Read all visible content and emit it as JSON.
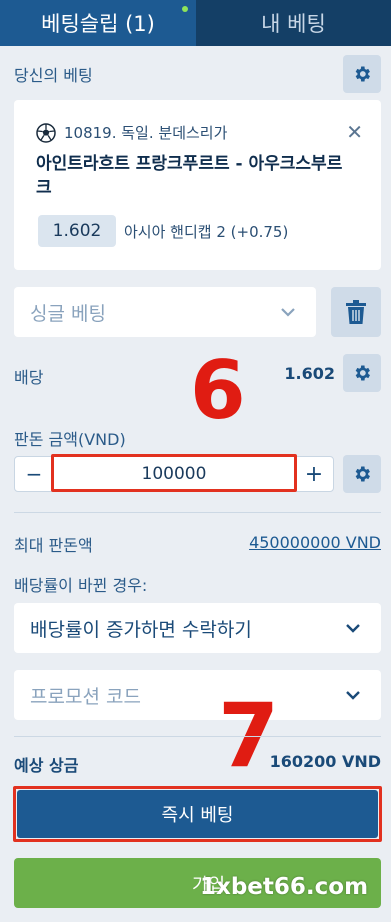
{
  "tabs": {
    "betslip": "베팅슬립 (1)",
    "my_bets": "내 베팅"
  },
  "your_bet_label": "당신의 베팅",
  "bet": {
    "league": "10819. 독일. 분데스리가",
    "match": "아인트라흐트 프랑크푸르트 - 아우크스부르크",
    "odds": "1.602",
    "market": "아시아 핸디캡 2 (+0.75)"
  },
  "bet_type": "싱글 베팅",
  "odds_row": {
    "label": "배당",
    "value": "1.602"
  },
  "stake": {
    "label": "판돈 금액(VND)",
    "value": "100000",
    "minus": "−",
    "plus": "+"
  },
  "max_stake": {
    "label": "최대 판돈액",
    "value": "450000000 VND"
  },
  "odds_change": {
    "label": "배당률이 바뀐 경우:",
    "option": "배당률이 증가하면 수락하기"
  },
  "promo": {
    "placeholder": "프로모션 코드"
  },
  "potential": {
    "label": "예상 상금",
    "value": "160200 VND"
  },
  "buttons": {
    "bet_now": "즉시 베팅",
    "join": "가입"
  },
  "annotations": {
    "step6": "6",
    "step7": "7"
  },
  "watermark": "1xbet66.com",
  "colors": {
    "primary": "#1d5a92",
    "dark_tab": "#143f66",
    "highlight": "#e2311f",
    "join": "#6cb04a"
  }
}
